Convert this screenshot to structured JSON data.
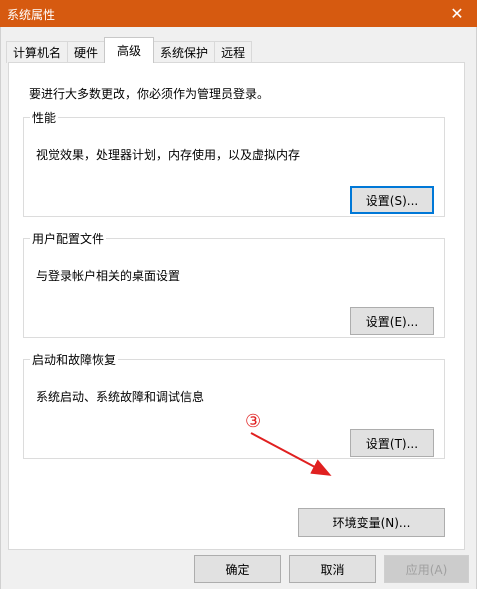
{
  "window": {
    "title": "系统属性",
    "close_glyph": "✕"
  },
  "tabs": [
    {
      "label": "计算机名",
      "active": false
    },
    {
      "label": "硬件",
      "active": false
    },
    {
      "label": "高级",
      "active": true
    },
    {
      "label": "系统保护",
      "active": false
    },
    {
      "label": "远程",
      "active": false
    }
  ],
  "advanced": {
    "intro": "要进行大多数更改，你必须作为管理员登录。",
    "performance": {
      "legend": "性能",
      "desc": "视觉效果，处理器计划，内存使用，以及虚拟内存",
      "button": "设置(S)..."
    },
    "user_profiles": {
      "legend": "用户配置文件",
      "desc": "与登录帐户相关的桌面设置",
      "button": "设置(E)..."
    },
    "startup_recovery": {
      "legend": "启动和故障恢复",
      "desc": "系统启动、系统故障和调试信息",
      "button": "设置(T)..."
    },
    "env_button": "环境变量(N)..."
  },
  "annotation": {
    "number": "③",
    "color": "#e02020"
  },
  "footer": {
    "ok": "确定",
    "cancel": "取消",
    "apply": "应用(A)"
  },
  "colors": {
    "titlebar": "#d65a10",
    "focus_border": "#0078d7"
  }
}
